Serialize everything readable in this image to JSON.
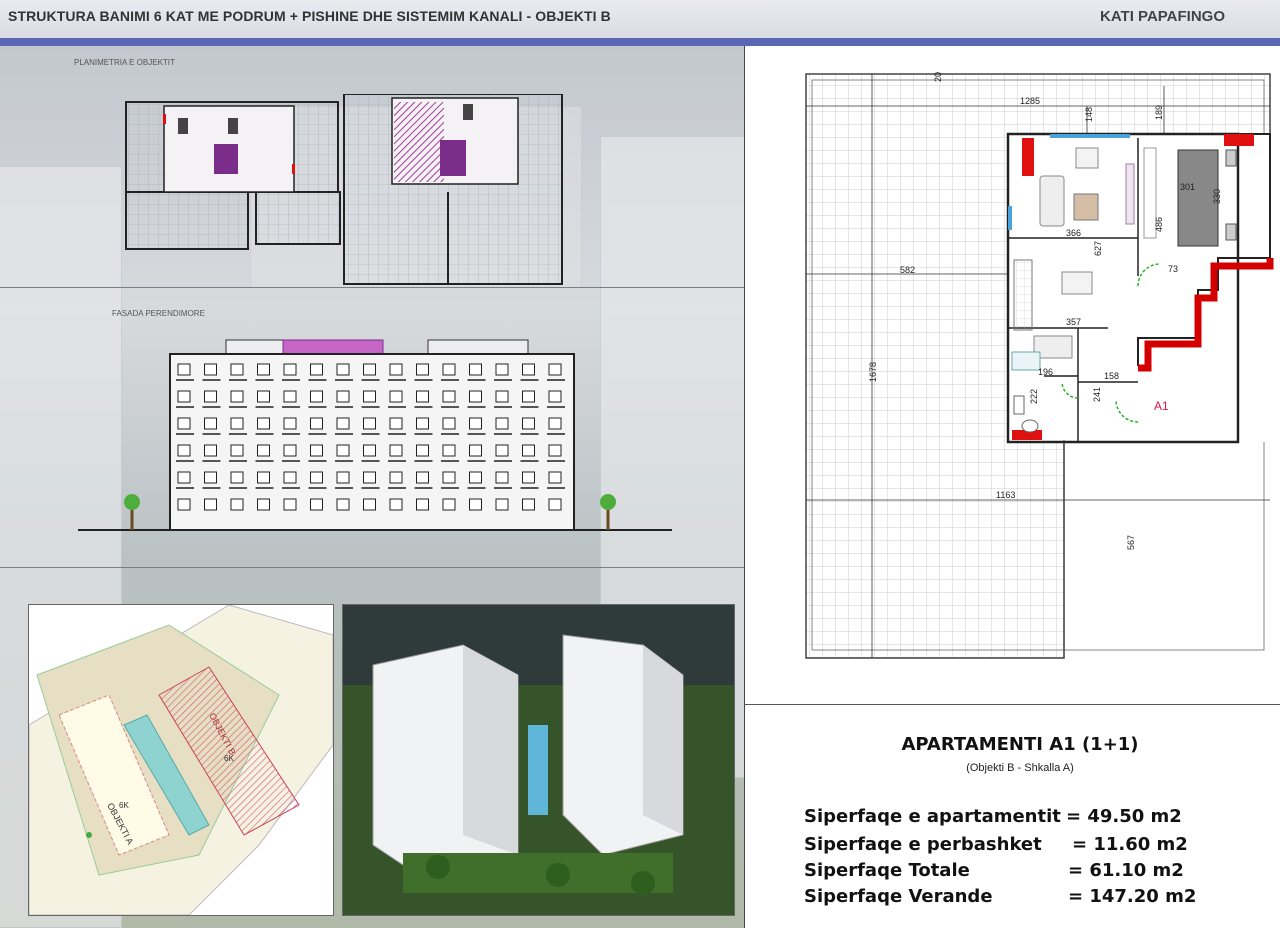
{
  "header": {
    "title": "STRUKTURA BANIMI 6 KAT ME PODRUM + PISHINE DHE SISTEMIM KANALI   -  OBJEKTI B",
    "floor": "KATI PAPAFINGO"
  },
  "left": {
    "site_plan_label": "PLANIMETRIA E OBJEKTIT",
    "facade_label": "FASADA PERENDIMORE",
    "site_tags": [
      "OBJEKTI A",
      "OBJEKTI B",
      "6K",
      "6K"
    ]
  },
  "plan": {
    "dims": [
      "20",
      "1285",
      "148",
      "189",
      "301",
      "330",
      "486",
      "366",
      "627",
      "582",
      "73",
      "357",
      "1678",
      "196",
      "158",
      "222",
      "241",
      "1163",
      "567"
    ],
    "unit_label": "A1"
  },
  "apartment": {
    "title": "APARTAMENTI A1 (1+1)",
    "subtitle": "(Objekti B - Shkalla A)",
    "areas": [
      {
        "label": "Siperfaqe e apartamentit",
        "value": "= 49.50 m2"
      },
      {
        "label": "Siperfaqe e perbashket",
        "value": "= 11.60 m2"
      },
      {
        "label": "Siperfaqe Totale",
        "value": "= 61.10 m2"
      },
      {
        "label": "Siperfaqe Verande",
        "value": "= 147.20 m2"
      }
    ]
  },
  "colors": {
    "accent_blue": "#5b66b4",
    "wall_red": "#e01010",
    "highlight_purple": "#8a3a9a"
  }
}
